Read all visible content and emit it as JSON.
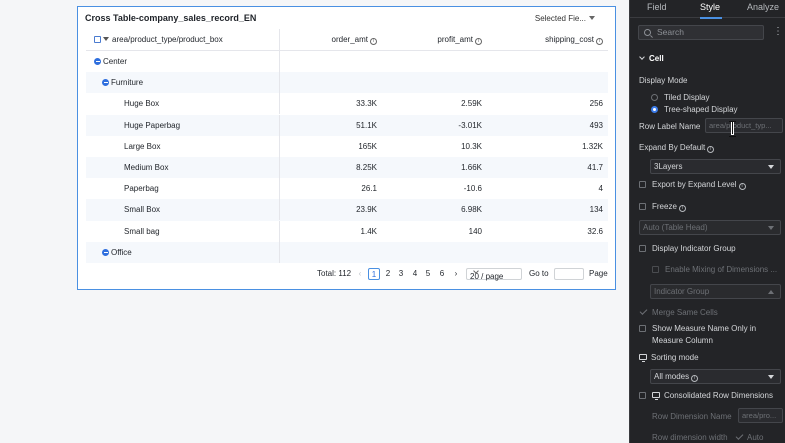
{
  "card": {
    "title": "Cross Table-company_sales_record_EN",
    "selected_fields_label": "Selected Fie..."
  },
  "table": {
    "row_header": "area/product_type/product_box",
    "columns": [
      "order_amt",
      "profit_amt",
      "shipping_cost"
    ],
    "rows": [
      {
        "label": "Center",
        "level": 0,
        "group": true,
        "values": [
          "",
          "",
          ""
        ]
      },
      {
        "label": "Furniture",
        "level": 1,
        "group": true,
        "values": [
          "",
          "",
          ""
        ]
      },
      {
        "label": "Huge Box",
        "level": 2,
        "group": false,
        "values": [
          "33.3K",
          "2.59K",
          "256"
        ]
      },
      {
        "label": "Huge Paperbag",
        "level": 2,
        "group": false,
        "values": [
          "51.1K",
          "-3.01K",
          "493"
        ]
      },
      {
        "label": "Large Box",
        "level": 2,
        "group": false,
        "values": [
          "165K",
          "10.3K",
          "1.32K"
        ]
      },
      {
        "label": "Medium Box",
        "level": 2,
        "group": false,
        "values": [
          "8.25K",
          "1.66K",
          "41.7"
        ]
      },
      {
        "label": "Paperbag",
        "level": 2,
        "group": false,
        "values": [
          "26.1",
          "-10.6",
          "4"
        ]
      },
      {
        "label": "Small Box",
        "level": 2,
        "group": false,
        "values": [
          "23.9K",
          "6.98K",
          "134"
        ]
      },
      {
        "label": "Small bag",
        "level": 2,
        "group": false,
        "values": [
          "1.4K",
          "140",
          "32.6"
        ]
      },
      {
        "label": "Office",
        "level": 1,
        "group": true,
        "values": [
          "",
          "",
          ""
        ]
      }
    ]
  },
  "pagination": {
    "total": "Total: 112",
    "prev": "‹",
    "pages": [
      "1",
      "2",
      "3",
      "4",
      "5",
      "6"
    ],
    "next": "›",
    "page_size": "20 / page",
    "goto_label": "Go to",
    "page_label": "Page"
  },
  "panel": {
    "tabs": [
      "Field",
      "Style",
      "Analyze"
    ],
    "active_tab": "Style",
    "search_placeholder": "Search",
    "more": "⋮",
    "section": "Cell",
    "display_mode_label": "Display Mode",
    "tiled_display": "Tiled Display",
    "tree_display": "Tree-shaped Display",
    "row_label_name": "Row Label Name",
    "row_label_placeholder": "area/product_typ...",
    "expand_by_default": "Expand By Default",
    "expand_value": "3Layers",
    "export_by_expand": "Export by Expand Level",
    "freeze": "Freeze",
    "freeze_select": "Auto (Table Head)",
    "display_indicator_group": "Display Indicator Group",
    "enable_mixing": "Enable Mixing of Dimensions ...",
    "indicator_group": "Indicator Group",
    "merge_same_cells": "Merge Same Cells",
    "show_measure_name_1": "Show Measure Name Only in",
    "show_measure_name_2": "Measure Column",
    "sorting_mode": "Sorting mode",
    "sorting_value": "All modes",
    "consolidated_row_dims": "Consolidated Row Dimensions",
    "row_dimension_name": "Row Dimension Name",
    "row_dimension_placeholder": "area/pro...",
    "row_dimension_width": "Row dimension width",
    "auto": "Auto"
  },
  "colors": {
    "accent": "#2f6fde",
    "panel_bg": "#232427",
    "card_border": "#4a90e2"
  }
}
